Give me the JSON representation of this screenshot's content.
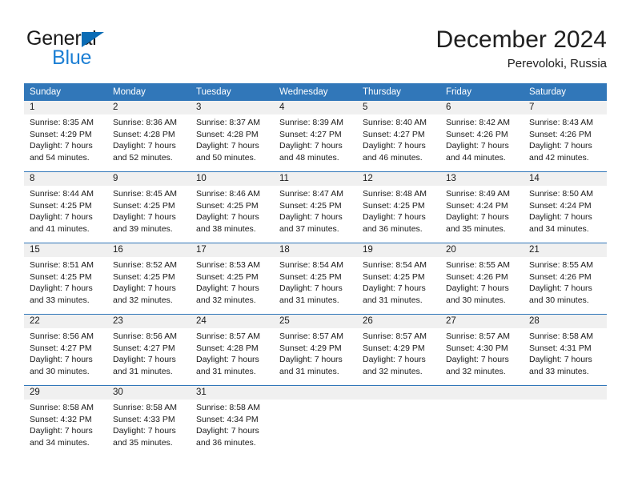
{
  "brand": {
    "name_part1": "General",
    "name_part2": "Blue",
    "triangle_color": "#0b6cb5",
    "blue_color": "#1c7fd4"
  },
  "header": {
    "title": "December 2024",
    "subtitle": "Perevoloki, Russia",
    "accent_color": "#3177b9",
    "datebar_color": "#f0f0f0"
  },
  "weekday_headers": [
    "Sunday",
    "Monday",
    "Tuesday",
    "Wednesday",
    "Thursday",
    "Friday",
    "Saturday"
  ],
  "labels": {
    "sunrise_prefix": "Sunrise:",
    "sunset_prefix": "Sunset:",
    "daylight_prefix": "Daylight:"
  },
  "weeks": [
    [
      {
        "date": "1",
        "sunrise": "Sunrise: 8:35 AM",
        "sunset": "Sunset: 4:29 PM",
        "daylight1": "Daylight: 7 hours",
        "daylight2": "and 54 minutes."
      },
      {
        "date": "2",
        "sunrise": "Sunrise: 8:36 AM",
        "sunset": "Sunset: 4:28 PM",
        "daylight1": "Daylight: 7 hours",
        "daylight2": "and 52 minutes."
      },
      {
        "date": "3",
        "sunrise": "Sunrise: 8:37 AM",
        "sunset": "Sunset: 4:28 PM",
        "daylight1": "Daylight: 7 hours",
        "daylight2": "and 50 minutes."
      },
      {
        "date": "4",
        "sunrise": "Sunrise: 8:39 AM",
        "sunset": "Sunset: 4:27 PM",
        "daylight1": "Daylight: 7 hours",
        "daylight2": "and 48 minutes."
      },
      {
        "date": "5",
        "sunrise": "Sunrise: 8:40 AM",
        "sunset": "Sunset: 4:27 PM",
        "daylight1": "Daylight: 7 hours",
        "daylight2": "and 46 minutes."
      },
      {
        "date": "6",
        "sunrise": "Sunrise: 8:42 AM",
        "sunset": "Sunset: 4:26 PM",
        "daylight1": "Daylight: 7 hours",
        "daylight2": "and 44 minutes."
      },
      {
        "date": "7",
        "sunrise": "Sunrise: 8:43 AM",
        "sunset": "Sunset: 4:26 PM",
        "daylight1": "Daylight: 7 hours",
        "daylight2": "and 42 minutes."
      }
    ],
    [
      {
        "date": "8",
        "sunrise": "Sunrise: 8:44 AM",
        "sunset": "Sunset: 4:25 PM",
        "daylight1": "Daylight: 7 hours",
        "daylight2": "and 41 minutes."
      },
      {
        "date": "9",
        "sunrise": "Sunrise: 8:45 AM",
        "sunset": "Sunset: 4:25 PM",
        "daylight1": "Daylight: 7 hours",
        "daylight2": "and 39 minutes."
      },
      {
        "date": "10",
        "sunrise": "Sunrise: 8:46 AM",
        "sunset": "Sunset: 4:25 PM",
        "daylight1": "Daylight: 7 hours",
        "daylight2": "and 38 minutes."
      },
      {
        "date": "11",
        "sunrise": "Sunrise: 8:47 AM",
        "sunset": "Sunset: 4:25 PM",
        "daylight1": "Daylight: 7 hours",
        "daylight2": "and 37 minutes."
      },
      {
        "date": "12",
        "sunrise": "Sunrise: 8:48 AM",
        "sunset": "Sunset: 4:25 PM",
        "daylight1": "Daylight: 7 hours",
        "daylight2": "and 36 minutes."
      },
      {
        "date": "13",
        "sunrise": "Sunrise: 8:49 AM",
        "sunset": "Sunset: 4:24 PM",
        "daylight1": "Daylight: 7 hours",
        "daylight2": "and 35 minutes."
      },
      {
        "date": "14",
        "sunrise": "Sunrise: 8:50 AM",
        "sunset": "Sunset: 4:24 PM",
        "daylight1": "Daylight: 7 hours",
        "daylight2": "and 34 minutes."
      }
    ],
    [
      {
        "date": "15",
        "sunrise": "Sunrise: 8:51 AM",
        "sunset": "Sunset: 4:25 PM",
        "daylight1": "Daylight: 7 hours",
        "daylight2": "and 33 minutes."
      },
      {
        "date": "16",
        "sunrise": "Sunrise: 8:52 AM",
        "sunset": "Sunset: 4:25 PM",
        "daylight1": "Daylight: 7 hours",
        "daylight2": "and 32 minutes."
      },
      {
        "date": "17",
        "sunrise": "Sunrise: 8:53 AM",
        "sunset": "Sunset: 4:25 PM",
        "daylight1": "Daylight: 7 hours",
        "daylight2": "and 32 minutes."
      },
      {
        "date": "18",
        "sunrise": "Sunrise: 8:54 AM",
        "sunset": "Sunset: 4:25 PM",
        "daylight1": "Daylight: 7 hours",
        "daylight2": "and 31 minutes."
      },
      {
        "date": "19",
        "sunrise": "Sunrise: 8:54 AM",
        "sunset": "Sunset: 4:25 PM",
        "daylight1": "Daylight: 7 hours",
        "daylight2": "and 31 minutes."
      },
      {
        "date": "20",
        "sunrise": "Sunrise: 8:55 AM",
        "sunset": "Sunset: 4:26 PM",
        "daylight1": "Daylight: 7 hours",
        "daylight2": "and 30 minutes."
      },
      {
        "date": "21",
        "sunrise": "Sunrise: 8:55 AM",
        "sunset": "Sunset: 4:26 PM",
        "daylight1": "Daylight: 7 hours",
        "daylight2": "and 30 minutes."
      }
    ],
    [
      {
        "date": "22",
        "sunrise": "Sunrise: 8:56 AM",
        "sunset": "Sunset: 4:27 PM",
        "daylight1": "Daylight: 7 hours",
        "daylight2": "and 30 minutes."
      },
      {
        "date": "23",
        "sunrise": "Sunrise: 8:56 AM",
        "sunset": "Sunset: 4:27 PM",
        "daylight1": "Daylight: 7 hours",
        "daylight2": "and 31 minutes."
      },
      {
        "date": "24",
        "sunrise": "Sunrise: 8:57 AM",
        "sunset": "Sunset: 4:28 PM",
        "daylight1": "Daylight: 7 hours",
        "daylight2": "and 31 minutes."
      },
      {
        "date": "25",
        "sunrise": "Sunrise: 8:57 AM",
        "sunset": "Sunset: 4:29 PM",
        "daylight1": "Daylight: 7 hours",
        "daylight2": "and 31 minutes."
      },
      {
        "date": "26",
        "sunrise": "Sunrise: 8:57 AM",
        "sunset": "Sunset: 4:29 PM",
        "daylight1": "Daylight: 7 hours",
        "daylight2": "and 32 minutes."
      },
      {
        "date": "27",
        "sunrise": "Sunrise: 8:57 AM",
        "sunset": "Sunset: 4:30 PM",
        "daylight1": "Daylight: 7 hours",
        "daylight2": "and 32 minutes."
      },
      {
        "date": "28",
        "sunrise": "Sunrise: 8:58 AM",
        "sunset": "Sunset: 4:31 PM",
        "daylight1": "Daylight: 7 hours",
        "daylight2": "and 33 minutes."
      }
    ],
    [
      {
        "date": "29",
        "sunrise": "Sunrise: 8:58 AM",
        "sunset": "Sunset: 4:32 PM",
        "daylight1": "Daylight: 7 hours",
        "daylight2": "and 34 minutes."
      },
      {
        "date": "30",
        "sunrise": "Sunrise: 8:58 AM",
        "sunset": "Sunset: 4:33 PM",
        "daylight1": "Daylight: 7 hours",
        "daylight2": "and 35 minutes."
      },
      {
        "date": "31",
        "sunrise": "Sunrise: 8:58 AM",
        "sunset": "Sunset: 4:34 PM",
        "daylight1": "Daylight: 7 hours",
        "daylight2": "and 36 minutes."
      },
      {
        "date": "",
        "sunrise": "",
        "sunset": "",
        "daylight1": "",
        "daylight2": ""
      },
      {
        "date": "",
        "sunrise": "",
        "sunset": "",
        "daylight1": "",
        "daylight2": ""
      },
      {
        "date": "",
        "sunrise": "",
        "sunset": "",
        "daylight1": "",
        "daylight2": ""
      },
      {
        "date": "",
        "sunrise": "",
        "sunset": "",
        "daylight1": "",
        "daylight2": ""
      }
    ]
  ]
}
